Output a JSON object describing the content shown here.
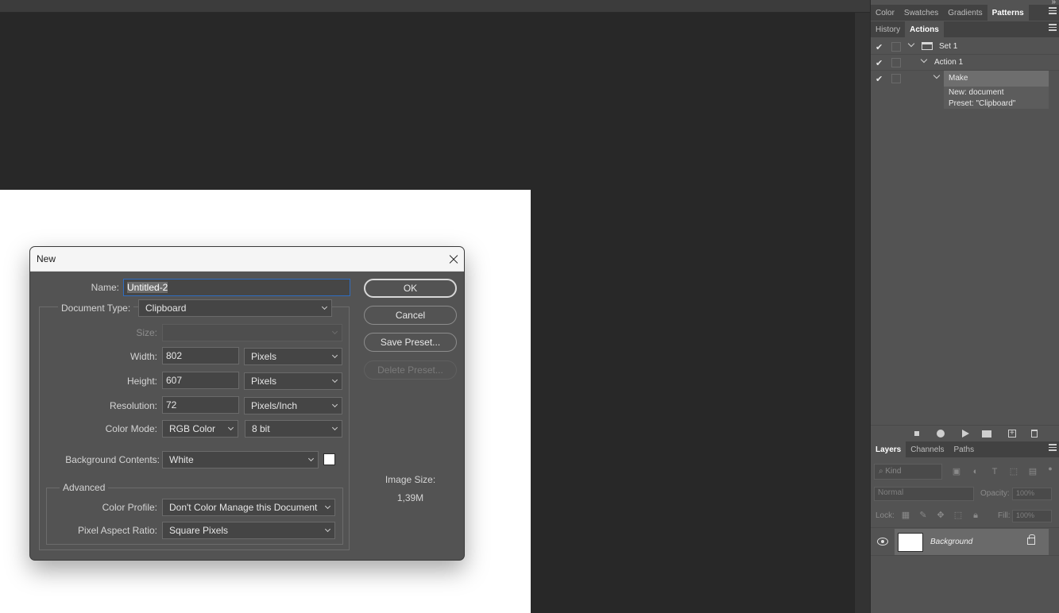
{
  "panels": {
    "top_tabs": [
      "Color",
      "Swatches",
      "Gradients",
      "Patterns"
    ],
    "top_active": "Patterns",
    "mid_tabs": [
      "History",
      "Actions"
    ],
    "mid_active": "Actions",
    "actions": {
      "set_label": "Set 1",
      "action_label": "Action 1",
      "step_label": "Make",
      "step_detail_1": "New: document",
      "step_detail_2": "Preset:  \"Clipboard\"",
      "check": "✔"
    },
    "layer_tabs": [
      "Layers",
      "Channels",
      "Paths"
    ],
    "layer_active": "Layers",
    "layers": {
      "filter_placeholder": "Kind",
      "blend_mode": "Normal",
      "opacity_label": "Opacity:",
      "opacity_value": "100%",
      "lock_label": "Lock:",
      "fill_label": "Fill:",
      "fill_value": "100%",
      "layer_name": "Background"
    }
  },
  "dialog": {
    "title": "New",
    "name_label": "Name:",
    "name_value": "Untitled-2",
    "doc_type_label": "Document Type:",
    "doc_type_value": "Clipboard",
    "size_label": "Size:",
    "size_value": "",
    "width_label": "Width:",
    "width_value": "802",
    "width_unit": "Pixels",
    "height_label": "Height:",
    "height_value": "607",
    "height_unit": "Pixels",
    "resolution_label": "Resolution:",
    "resolution_value": "72",
    "resolution_unit": "Pixels/Inch",
    "color_mode_label": "Color Mode:",
    "color_mode_value": "RGB Color",
    "bit_depth_value": "8 bit",
    "bg_contents_label": "Background Contents:",
    "bg_contents_value": "White",
    "advanced_label": "Advanced",
    "color_profile_label": "Color Profile:",
    "color_profile_value": "Don't Color Manage this Document",
    "pixel_aspect_label": "Pixel Aspect Ratio:",
    "pixel_aspect_value": "Square Pixels",
    "ok_label": "OK",
    "cancel_label": "Cancel",
    "save_preset_label": "Save Preset...",
    "delete_preset_label": "Delete Preset...",
    "image_size_label": "Image Size:",
    "image_size_value": "1,39M"
  }
}
